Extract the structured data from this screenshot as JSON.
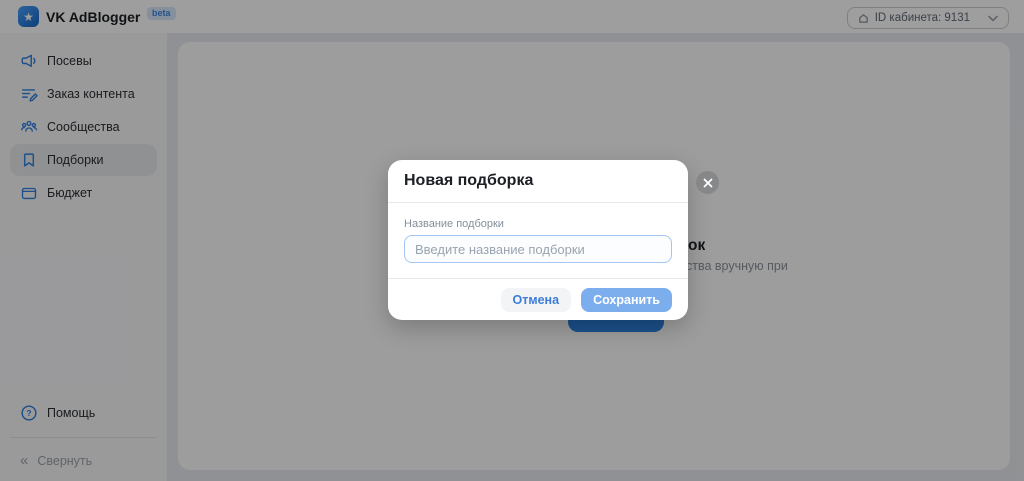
{
  "header": {
    "app_title": "VK AdBlogger",
    "beta_badge": "beta",
    "cabinet_selector": "ID кабинета: 9131"
  },
  "sidebar": {
    "items": [
      {
        "label": "Посевы",
        "icon": "megaphone-icon",
        "selected": false
      },
      {
        "label": "Заказ контента",
        "icon": "content-order-icon",
        "selected": false
      },
      {
        "label": "Сообщества",
        "icon": "communities-icon",
        "selected": false
      },
      {
        "label": "Подборки",
        "icon": "bookmark-icon",
        "selected": true
      },
      {
        "label": "Бюджет",
        "icon": "wallet-icon",
        "selected": false
      }
    ],
    "help_label": "Помощь",
    "collapse_label": "Свернуть",
    "collapse_glyph": "«"
  },
  "background_page": {
    "heading_fragment": "ок",
    "subtext_fragment": "ства вручную при"
  },
  "modal": {
    "title": "Новая подборка",
    "field_label": "Название подборки",
    "input_value": "",
    "input_placeholder": "Введите название подборки",
    "cancel_label": "Отмена",
    "save_label": "Сохранить"
  },
  "colors": {
    "accent_blue": "#2d81e0",
    "save_button_blue": "#7caeee",
    "input_border_blue": "#a3c6f2",
    "overlay": "rgba(0,0,0,0.38)"
  },
  "logo_glyph": "★"
}
